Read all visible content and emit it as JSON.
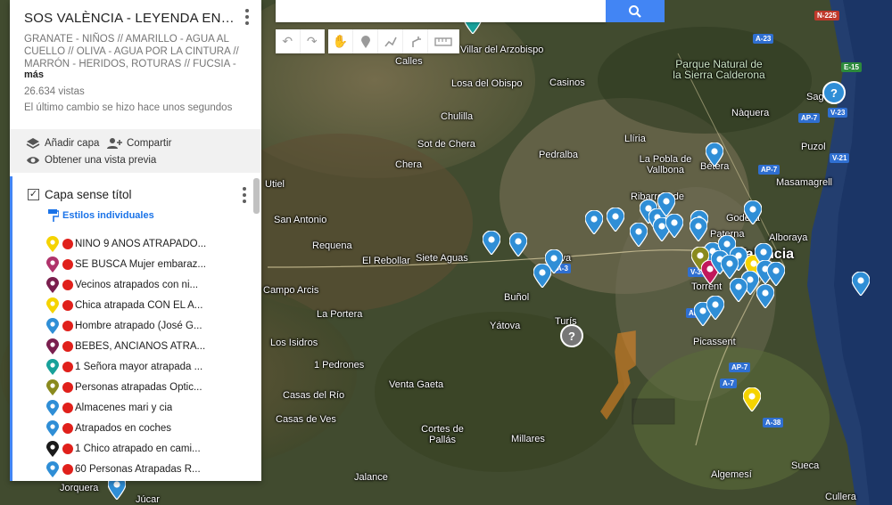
{
  "panel": {
    "title": "SOS VALÈNCIA - LEYENDA EN DE...",
    "description": "GRANATE - NIÑOS // AMARILLO - AGUA AL CUELLO // OLIVA - AGUA POR LA CINTURA // MARRÓN - HERIDOS, ROTURAS // FUCSIA -",
    "more": "más",
    "views": "26.634 vistas",
    "last_change": "El último cambio se hizo hace unos segundos",
    "actions": {
      "add_layer": "Añadir capa",
      "share": "Compartir",
      "preview": "Obtener una vista previa"
    },
    "layer": {
      "name": "Capa sense títol",
      "styles_link": "Estilos individuales",
      "checked": true,
      "items": [
        {
          "label": "NIÑO 9 AÑOS ATRAPADO...",
          "color": "#f5d300"
        },
        {
          "label": "SE BUSCA Mujer embaraz...",
          "color": "#b0336b"
        },
        {
          "label": "Vecinos atrapados con ni...",
          "color": "#7a1f4e"
        },
        {
          "label": "Chica atrapada CON EL A...",
          "color": "#f5d300"
        },
        {
          "label": "Hombre atrapado (José G...",
          "color": "#2f8ed6"
        },
        {
          "label": "BEBES, ANCIANOS ATRA...",
          "color": "#7a1f4e"
        },
        {
          "label": "1 Señora mayor atrapada ...",
          "color": "#18a19a"
        },
        {
          "label": "Personas atrapadas Óptic...",
          "color": "#8a8a1e"
        },
        {
          "label": "Almacenes mari y cia",
          "color": "#2f8ed6"
        },
        {
          "label": "Atrapados en coches",
          "color": "#2f8ed6"
        },
        {
          "label": "1 Chico atrapado en cami...",
          "color": "#1a1a1a"
        },
        {
          "label": "60 Personas Atrapadas R...",
          "color": "#2f8ed6"
        }
      ]
    }
  },
  "map": {
    "place_labels": [
      {
        "name": "Villar del Arzobispo",
        "type": "town"
      },
      {
        "name": "Calles",
        "type": "town"
      },
      {
        "name": "Losa del Obispo",
        "type": "town"
      },
      {
        "name": "Casinos",
        "type": "town"
      },
      {
        "name": "Chulilla",
        "type": "town"
      },
      {
        "name": "Parque Natural de la Sierra Calderona",
        "type": "park"
      },
      {
        "name": "Nàquera",
        "type": "town"
      },
      {
        "name": "Sagunto",
        "type": "town"
      },
      {
        "name": "Sot de Chera",
        "type": "town"
      },
      {
        "name": "Pedralba",
        "type": "town"
      },
      {
        "name": "Llíria",
        "type": "town"
      },
      {
        "name": "Puzol",
        "type": "town"
      },
      {
        "name": "Chera",
        "type": "town"
      },
      {
        "name": "La Pobla de Vallbona",
        "type": "town"
      },
      {
        "name": "Bétera",
        "type": "town"
      },
      {
        "name": "Masamagrell",
        "type": "town"
      },
      {
        "name": "Utiel",
        "type": "town"
      },
      {
        "name": "Ribarroja de Turia",
        "type": "town"
      },
      {
        "name": "San Antonio",
        "type": "town"
      },
      {
        "name": "Godella",
        "type": "town"
      },
      {
        "name": "Alboraya",
        "type": "town"
      },
      {
        "name": "Paterna",
        "type": "town"
      },
      {
        "name": "Requena",
        "type": "town"
      },
      {
        "name": "El Rebollar",
        "type": "town"
      },
      {
        "name": "Siete Aguas",
        "type": "town"
      },
      {
        "name": "Chiva",
        "type": "town"
      },
      {
        "name": "Valencia",
        "type": "city"
      },
      {
        "name": "Campo Arcis",
        "type": "town"
      },
      {
        "name": "Buñol",
        "type": "town"
      },
      {
        "name": "Torrent",
        "type": "town"
      },
      {
        "name": "La Portera",
        "type": "town"
      },
      {
        "name": "Yátova",
        "type": "town"
      },
      {
        "name": "Turís",
        "type": "town"
      },
      {
        "name": "Picassent",
        "type": "town"
      },
      {
        "name": "Los Isidros",
        "type": "town"
      },
      {
        "name": "1 Pedrones",
        "type": "town"
      },
      {
        "name": "Venta Gaeta",
        "type": "town"
      },
      {
        "name": "Casas del Río",
        "type": "town"
      },
      {
        "name": "Casas de Ves",
        "type": "town"
      },
      {
        "name": "Cortes de Pallás",
        "type": "town"
      },
      {
        "name": "Millares",
        "type": "town"
      },
      {
        "name": "Sueca",
        "type": "town"
      },
      {
        "name": "Jalance",
        "type": "town"
      },
      {
        "name": "Algemesí",
        "type": "town"
      },
      {
        "name": "Jorquera",
        "type": "town"
      },
      {
        "name": "Júcar",
        "type": "town"
      },
      {
        "name": "Cullera",
        "type": "town"
      }
    ],
    "road_labels": [
      "N-225",
      "A-23",
      "E-15",
      "AP-7",
      "V-23",
      "V-21",
      "A-3",
      "A-3",
      "AP-7",
      "A-7",
      "AP-7",
      "A-38",
      "V-31"
    ]
  },
  "colors": {
    "accent": "#4285f4",
    "pin_blue": "#2f8ed6",
    "pin_yellow": "#f5d300",
    "pin_olive": "#8a8a1e",
    "pin_magenta": "#c2185b",
    "pin_teal": "#18a19a",
    "dot_red": "#e0201b",
    "flood_orange": "#f08a24"
  }
}
